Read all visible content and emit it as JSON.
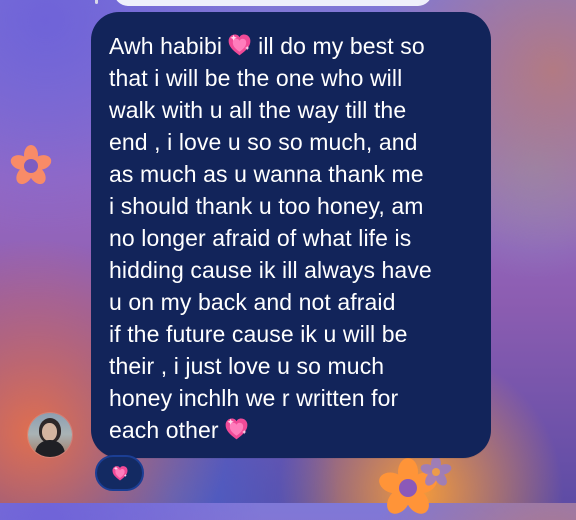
{
  "message": {
    "lines": [
      {
        "before": "Awh habibi",
        "icon": "sparkling-heart-icon",
        "after": "ill do my best so"
      },
      {
        "text": "that i will be the one who will"
      },
      {
        "text": "walk with u all the way till the"
      },
      {
        "text": "end , i love u so so much, and"
      },
      {
        "text": "as much as u wanna thank me"
      },
      {
        "text": "i should thank u too honey, am"
      },
      {
        "text": "no longer afraid of what life is"
      },
      {
        "text": "hidding cause ik ill always have"
      },
      {
        "text": "u on my back and not afraid"
      },
      {
        "text": "if the future cause ik u will be"
      },
      {
        "text": "their , i just love u so much"
      },
      {
        "text": "honey inchlh we r written for"
      },
      {
        "before": "each other",
        "icon": "sparkling-heart-icon"
      }
    ]
  },
  "reaction": {
    "icon": "sparkling-heart-icon"
  },
  "sender": {
    "avatar": "person-avatar"
  },
  "colors": {
    "bubble": "#12245a",
    "text": "#ffffff",
    "heart": "#f14a97",
    "reaction_border": "#1b3e94"
  }
}
